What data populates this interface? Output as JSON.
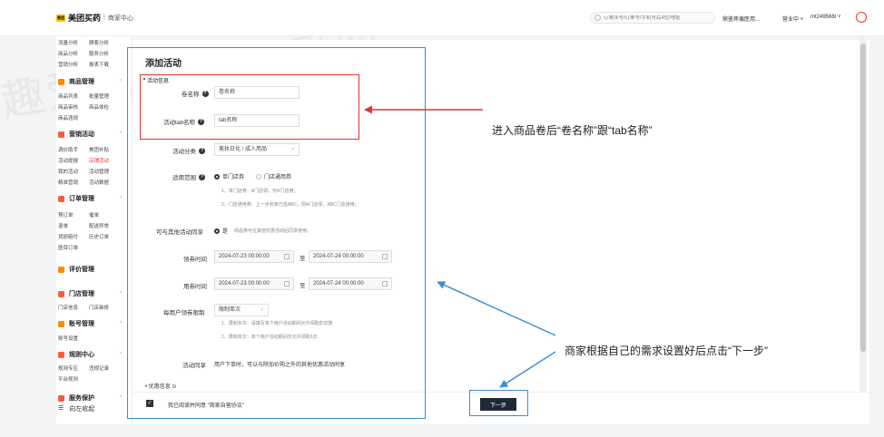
{
  "header": {
    "logo_mark": "美团",
    "brand": "美团买药",
    "separator": "|",
    "portal": "商家中心",
    "search_placeholder": "订单序号/订单号/手机号后4位/地址",
    "store": "鼎鉴疼痛医用...",
    "status": "营业中 ˅",
    "user": "mt249566t ˅"
  },
  "sidebar": {
    "rows_top": [
      [
        "流量分析",
        "顾客分析"
      ],
      [
        "商品分析",
        "服务分析"
      ],
      [
        "营销分析",
        "报表下载"
      ]
    ],
    "goods_head": "商品管理",
    "goods_rows": [
      [
        "商品列表",
        "批量管理"
      ],
      [
        "商品审核",
        "商品体检"
      ],
      [
        "商品违规",
        ""
      ]
    ],
    "market_head": "营销活动",
    "market_rows": [
      [
        "调价助手",
        "美团补贴"
      ],
      [
        "活动提报",
        "店铺活动"
      ],
      [
        "我的活动",
        "活动管理"
      ],
      [
        "精准营销",
        "活动数据"
      ]
    ],
    "order_head": "订单管理",
    "order_rows": [
      [
        "预订单",
        "催单"
      ],
      [
        "退单",
        "配送异常"
      ],
      [
        "货损赔付",
        "历史订单"
      ],
      [
        "医保订单",
        ""
      ]
    ],
    "review_head": "评价管理",
    "store_head": "门店管理",
    "store_rows": [
      [
        "门店信息",
        "门店装修"
      ]
    ],
    "account_head": "账号管理",
    "account_rows": [
      [
        "账号设置",
        ""
      ]
    ],
    "rules_head": "规则中心",
    "rules_rows": [
      [
        "规则专区",
        "违规记录"
      ],
      [
        "平台规则",
        ""
      ]
    ],
    "data_head": "服务保护",
    "collapse": "向左收起",
    "caret": "^"
  },
  "form": {
    "page_title": "添加活动",
    "section": "活动信息",
    "coupon_name_label": "卷名称",
    "coupon_name_value": "卷名称",
    "tab_name_label": "活动tab名称",
    "tab_name_value": "tab名称",
    "category_label": "活动分类",
    "category_value": "美妆日化 / 成人用品",
    "scope_label": "适用范围",
    "scope_opt1": "单门店券",
    "scope_opt2": "门店通用券",
    "scope_note1": "1、单门店券：A门店领，仅A门店用；",
    "scope_note2": "2、门店通用券：上一步商家已选ABC，则A门店领，ABC门店通用；",
    "share_label": "可与其他活动同享",
    "share_opt": "是",
    "share_note": "商品券可在其他优惠活动后同享使用。",
    "claim_label": "领券时间",
    "claim_start": "2024-07-23 00:00:00",
    "claim_end": "2024-07-24 00:00:00",
    "use_label": "用券时间",
    "use_start": "2024-07-23 00:00:00",
    "use_end": "2024-07-24 00:00:00",
    "to": "至",
    "limit_label": "每用户领券限制",
    "limit_value": "限制单次",
    "limit_note1": "1、限制多次：请填写单个用户活动期间允许领取的次数",
    "limit_note2": "2、限制单次：单个用户活动期间仅允许领取1次",
    "sharing_label": "活动同享",
    "sharing_value": "用户下单时，可以与除加价购之外的其他优惠活动同享",
    "preferential": "• 优惠信息 ⊙",
    "agree": "我已阅读并同意 \"商家自营协议\"",
    "next": "下一步",
    "chev": "˅",
    "q": "?",
    "check": "✓"
  },
  "annotations": {
    "top": "进入商品卷后“卷名称”跟“tab名称”",
    "bottom": "商家根据自己的需求设置好后点击“下一步”"
  },
  "watermark": "趣爱阁",
  "colors": {
    "red": "#e2332b",
    "blue": "#3a90d8",
    "brand_yellow": "#ffc300"
  }
}
